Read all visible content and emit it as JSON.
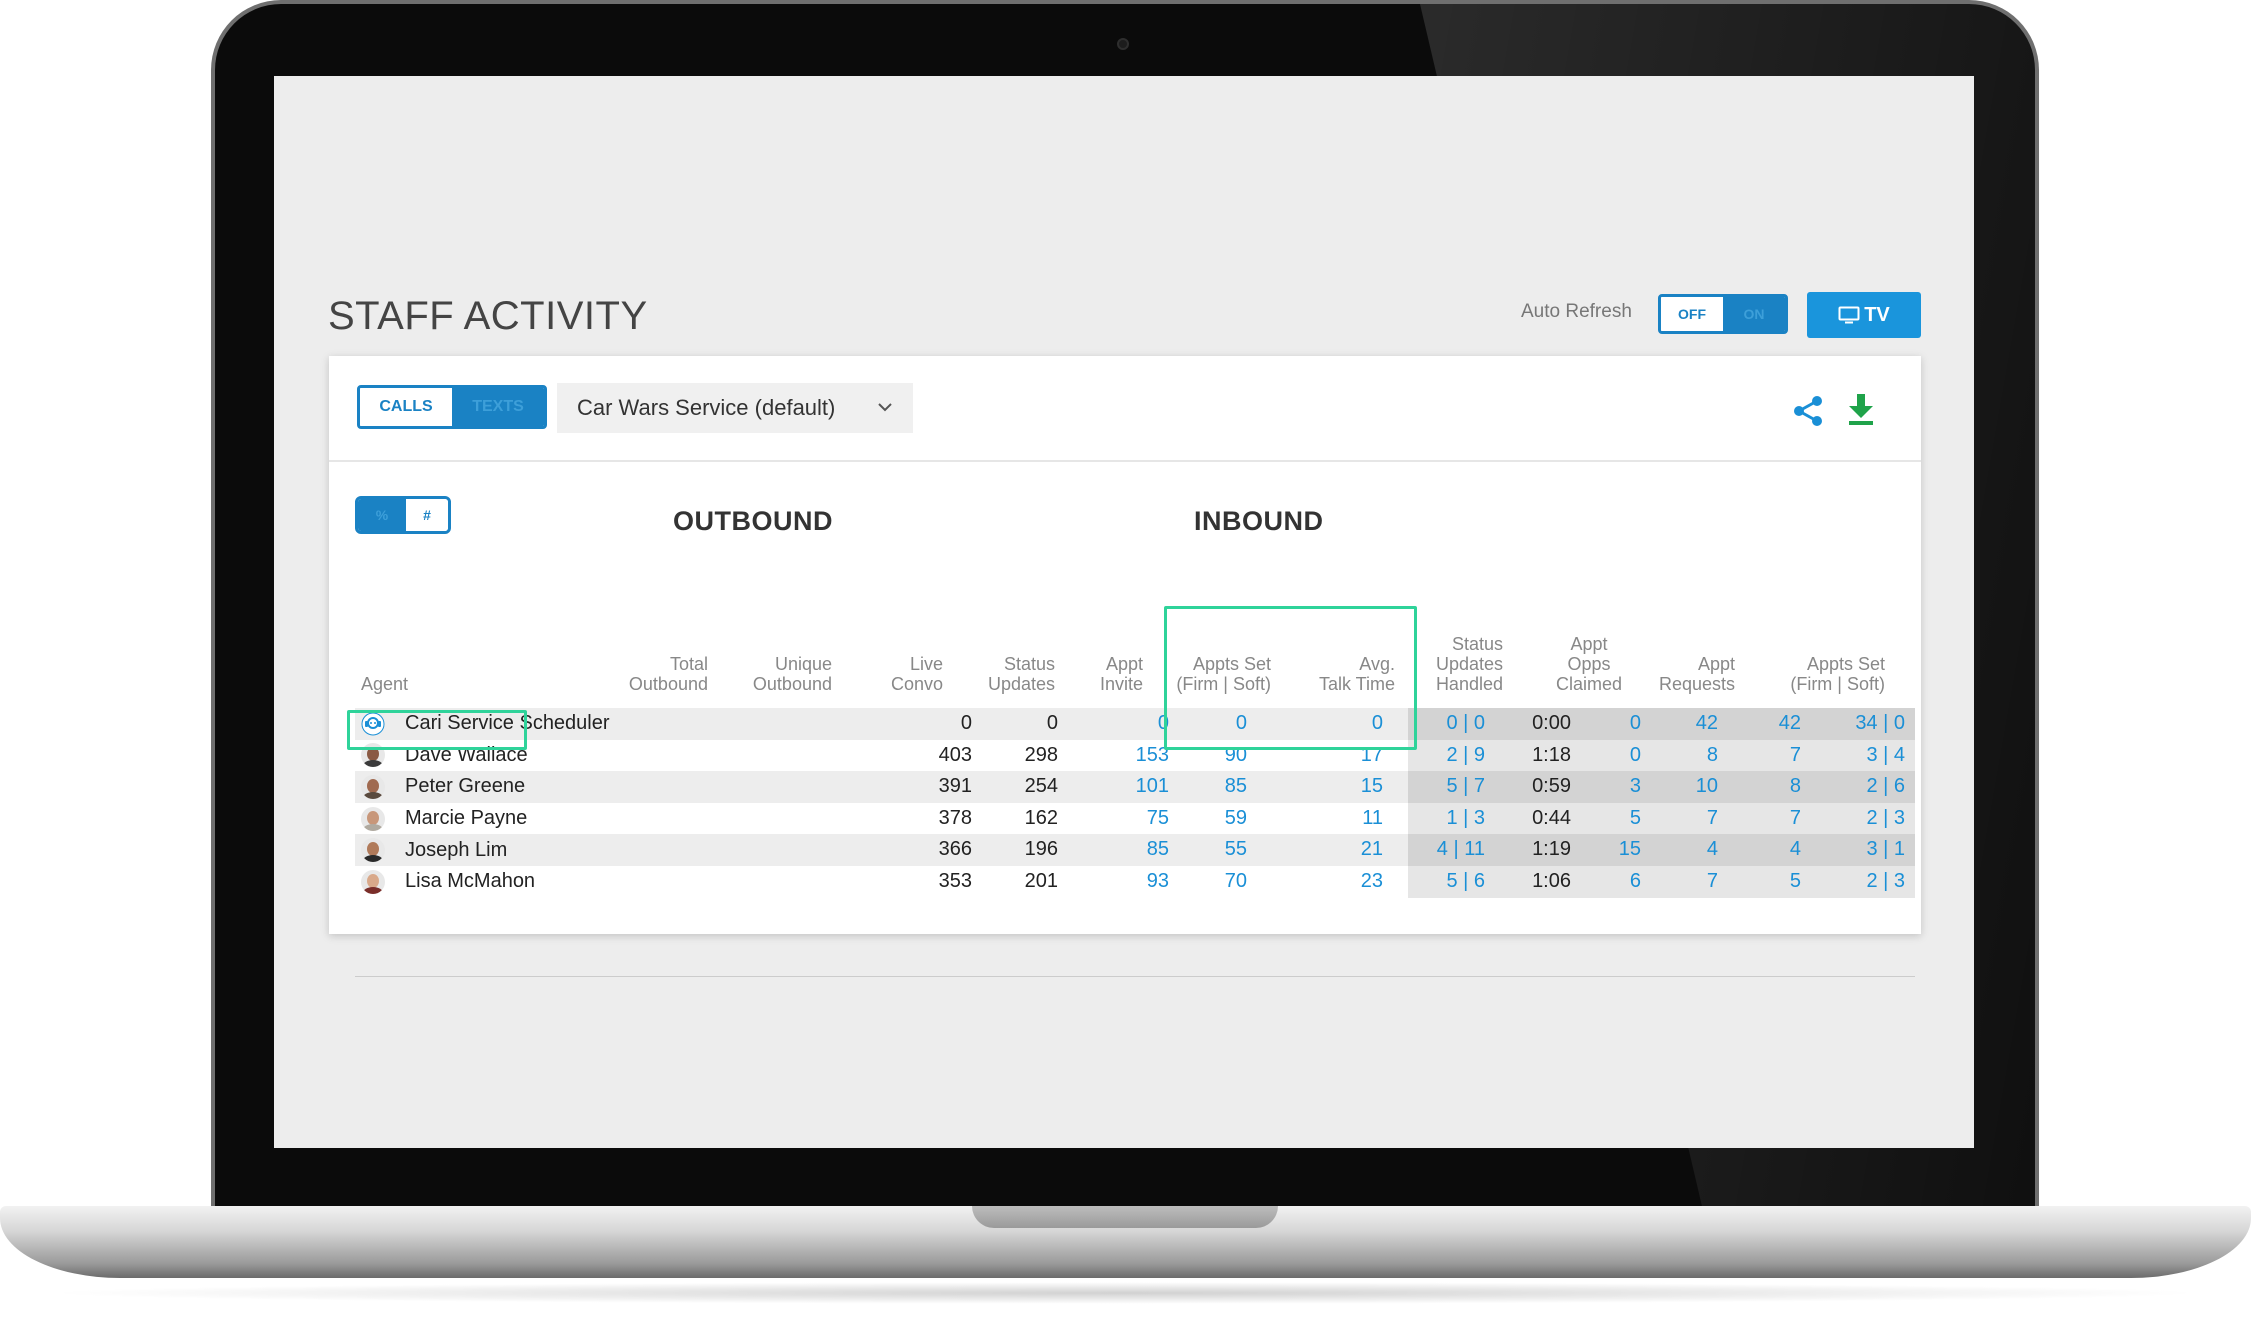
{
  "page": {
    "title": "STAFF ACTIVITY",
    "auto_refresh_label": "Auto Refresh",
    "auto_refresh_off": "OFF",
    "auto_refresh_on": "ON",
    "tv_label": "TV"
  },
  "toolbar": {
    "calls_label": "CALLS",
    "texts_label": "TEXTS",
    "dropdown_value": "Car Wars Service (default)"
  },
  "view_toggle": {
    "percent_label": "%",
    "count_label": "#"
  },
  "groups": {
    "outbound": "OUTBOUND",
    "inbound": "INBOUND"
  },
  "columns": {
    "agent": "Agent",
    "total_outbound": [
      "Total",
      "Outbound"
    ],
    "unique_outbound": [
      "Unique",
      "Outbound"
    ],
    "live_convo": [
      "Live",
      "Convo"
    ],
    "status_updates": [
      "Status",
      "Updates"
    ],
    "appt_invite": [
      "Appt",
      "Invite"
    ],
    "appts_set_out": [
      "Appts Set",
      "(Firm | Soft)"
    ],
    "avg_talk_time": [
      "Avg.",
      "Talk Time"
    ],
    "status_updates_handled": [
      "Status",
      "Updates",
      "Handled"
    ],
    "appt_opps_claimed": [
      "Appt",
      "Opps",
      "Claimed"
    ],
    "appt_requests": [
      "Appt",
      "Requests"
    ],
    "appts_set_in": [
      "Appts Set",
      "(Firm | Soft)"
    ]
  },
  "rows": [
    {
      "agent": "Cari Service Scheduler",
      "total": "0",
      "unique": "0",
      "live": "0",
      "status": "0",
      "invite": "0",
      "set_out": "0 | 0",
      "talk": "0:00",
      "handled": "0",
      "claimed": "42",
      "requests": "42",
      "set_in": "34 | 0"
    },
    {
      "agent": "Dave Wallace",
      "total": "403",
      "unique": "298",
      "live": "153",
      "status": "90",
      "invite": "17",
      "set_out": "2 | 9",
      "talk": "1:18",
      "handled": "0",
      "claimed": "8",
      "requests": "7",
      "set_in": "3 | 4"
    },
    {
      "agent": "Peter Greene",
      "total": "391",
      "unique": "254",
      "live": "101",
      "status": "85",
      "invite": "15",
      "set_out": "5 | 7",
      "talk": "0:59",
      "handled": "3",
      "claimed": "10",
      "requests": "8",
      "set_in": "2 | 6"
    },
    {
      "agent": "Marcie Payne",
      "total": "378",
      "unique": "162",
      "live": "75",
      "status": "59",
      "invite": "11",
      "set_out": "1 | 3",
      "talk": "0:44",
      "handled": "5",
      "claimed": "7",
      "requests": "7",
      "set_in": "2 | 3"
    },
    {
      "agent": "Joseph Lim",
      "total": "366",
      "unique": "196",
      "live": "85",
      "status": "55",
      "invite": "21",
      "set_out": "4 | 11",
      "talk": "1:19",
      "handled": "15",
      "claimed": "4",
      "requests": "4",
      "set_in": "3 | 1"
    },
    {
      "agent": "Lisa McMahon",
      "total": "353",
      "unique": "201",
      "live": "93",
      "status": "70",
      "invite": "23",
      "set_out": "5 | 6",
      "talk": "1:06",
      "handled": "6",
      "claimed": "7",
      "requests": "5",
      "set_in": "2 | 3"
    }
  ],
  "colors": {
    "accent": "#1a82c4",
    "link": "#1a8fd6",
    "highlight": "#2fd39a",
    "download": "#1fa34a"
  },
  "icons": {
    "share": "share-icon",
    "download": "download-icon",
    "tv": "tv-icon",
    "chevron": "chevron-down-icon",
    "bot_avatar": "headset-bot-icon"
  }
}
